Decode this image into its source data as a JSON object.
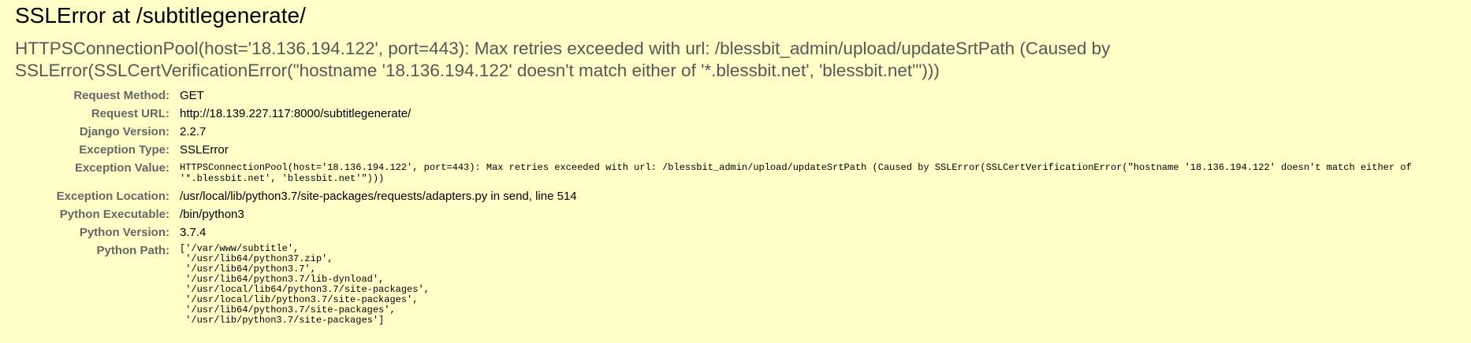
{
  "title": "SSLError at /subtitlegenerate/",
  "exception_message": "HTTPSConnectionPool(host='18.136.194.122', port=443): Max retries exceeded with url: /blessbit_admin/upload/updateSrtPath (Caused by SSLError(SSLCertVerificationError(\"hostname '18.136.194.122' doesn't match either of '*.blessbit.net', 'blessbit.net'\")))",
  "meta": {
    "request_method": {
      "label": "Request Method:",
      "value": "GET"
    },
    "request_url": {
      "label": "Request URL:",
      "value": "http://18.139.227.117:8000/subtitlegenerate/"
    },
    "django_version": {
      "label": "Django Version:",
      "value": "2.2.7"
    },
    "exception_type": {
      "label": "Exception Type:",
      "value": "SSLError"
    },
    "exception_value": {
      "label": "Exception Value:",
      "value": "HTTPSConnectionPool(host='18.136.194.122', port=443): Max retries exceeded with url: /blessbit_admin/upload/updateSrtPath (Caused by SSLError(SSLCertVerificationError(\"hostname '18.136.194.122' doesn't match either of '*.blessbit.net', 'blessbit.net'\")))"
    },
    "exception_location": {
      "label": "Exception Location:",
      "value": "/usr/local/lib/python3.7/site-packages/requests/adapters.py in send, line 514"
    },
    "python_executable": {
      "label": "Python Executable:",
      "value": "/bin/python3"
    },
    "python_version": {
      "label": "Python Version:",
      "value": "3.7.4"
    },
    "python_path": {
      "label": "Python Path:",
      "entries": [
        "['/var/www/subtitle',",
        " '/usr/lib64/python37.zip',",
        " '/usr/lib64/python3.7',",
        " '/usr/lib64/python3.7/lib-dynload',",
        " '/usr/local/lib64/python3.7/site-packages',",
        " '/usr/local/lib/python3.7/site-packages',",
        " '/usr/lib64/python3.7/site-packages',",
        " '/usr/lib/python3.7/site-packages']"
      ]
    }
  },
  "colors": {
    "background": "#ffffc8",
    "label_gray": "#666666",
    "subtitle_gray": "#575757"
  }
}
